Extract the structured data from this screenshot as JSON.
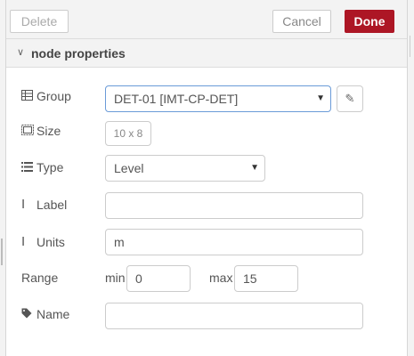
{
  "toolbar": {
    "delete_label": "Delete",
    "cancel_label": "Cancel",
    "done_label": "Done"
  },
  "section": {
    "title": "node properties",
    "chevron": "chevron-down-icon"
  },
  "form": {
    "group": {
      "label": "Group",
      "icon": "table-icon",
      "value": "DET-01 [IMT-CP-DET]",
      "edit_icon": "pencil-icon"
    },
    "size": {
      "label": "Size",
      "icon": "resize-icon",
      "value": "10 x 8"
    },
    "type": {
      "label": "Type",
      "icon": "list-icon",
      "value": "Level"
    },
    "label": {
      "label": "Label",
      "icon": "text-cursor-icon",
      "value": ""
    },
    "units": {
      "label": "Units",
      "icon": "text-cursor-icon",
      "value": "m"
    },
    "range": {
      "label": "Range",
      "min_label": "min",
      "min_value": "0",
      "max_label": "max",
      "max_value": "15"
    },
    "name": {
      "label": "Name",
      "icon": "tag-icon",
      "value": ""
    }
  },
  "colors": {
    "accent": "#ad1625",
    "border": "#cccccc",
    "header_bg": "#f3f3f3"
  }
}
